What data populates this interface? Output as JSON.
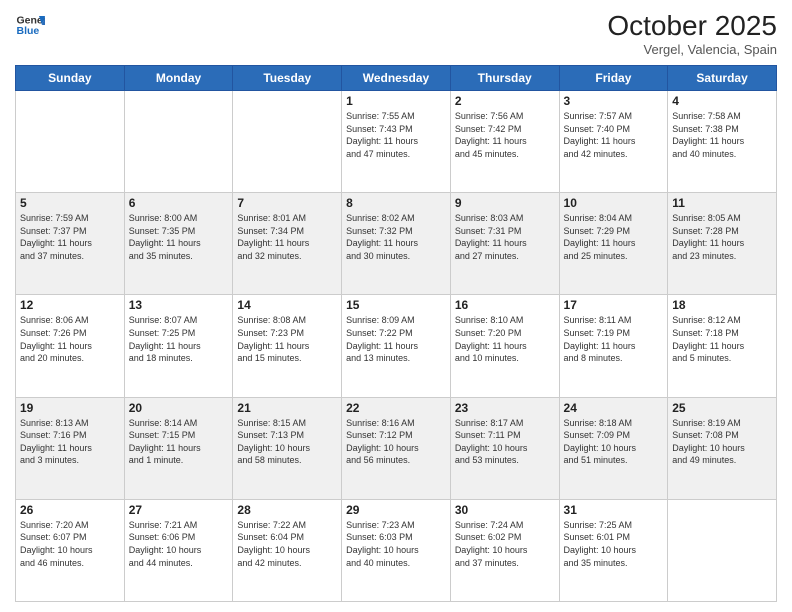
{
  "header": {
    "logo_line1": "General",
    "logo_line2": "Blue",
    "month_title": "October 2025",
    "location": "Vergel, Valencia, Spain"
  },
  "weekdays": [
    "Sunday",
    "Monday",
    "Tuesday",
    "Wednesday",
    "Thursday",
    "Friday",
    "Saturday"
  ],
  "weeks": [
    [
      {
        "day": "",
        "info": ""
      },
      {
        "day": "",
        "info": ""
      },
      {
        "day": "",
        "info": ""
      },
      {
        "day": "1",
        "info": "Sunrise: 7:55 AM\nSunset: 7:43 PM\nDaylight: 11 hours\nand 47 minutes."
      },
      {
        "day": "2",
        "info": "Sunrise: 7:56 AM\nSunset: 7:42 PM\nDaylight: 11 hours\nand 45 minutes."
      },
      {
        "day": "3",
        "info": "Sunrise: 7:57 AM\nSunset: 7:40 PM\nDaylight: 11 hours\nand 42 minutes."
      },
      {
        "day": "4",
        "info": "Sunrise: 7:58 AM\nSunset: 7:38 PM\nDaylight: 11 hours\nand 40 minutes."
      }
    ],
    [
      {
        "day": "5",
        "info": "Sunrise: 7:59 AM\nSunset: 7:37 PM\nDaylight: 11 hours\nand 37 minutes."
      },
      {
        "day": "6",
        "info": "Sunrise: 8:00 AM\nSunset: 7:35 PM\nDaylight: 11 hours\nand 35 minutes."
      },
      {
        "day": "7",
        "info": "Sunrise: 8:01 AM\nSunset: 7:34 PM\nDaylight: 11 hours\nand 32 minutes."
      },
      {
        "day": "8",
        "info": "Sunrise: 8:02 AM\nSunset: 7:32 PM\nDaylight: 11 hours\nand 30 minutes."
      },
      {
        "day": "9",
        "info": "Sunrise: 8:03 AM\nSunset: 7:31 PM\nDaylight: 11 hours\nand 27 minutes."
      },
      {
        "day": "10",
        "info": "Sunrise: 8:04 AM\nSunset: 7:29 PM\nDaylight: 11 hours\nand 25 minutes."
      },
      {
        "day": "11",
        "info": "Sunrise: 8:05 AM\nSunset: 7:28 PM\nDaylight: 11 hours\nand 23 minutes."
      }
    ],
    [
      {
        "day": "12",
        "info": "Sunrise: 8:06 AM\nSunset: 7:26 PM\nDaylight: 11 hours\nand 20 minutes."
      },
      {
        "day": "13",
        "info": "Sunrise: 8:07 AM\nSunset: 7:25 PM\nDaylight: 11 hours\nand 18 minutes."
      },
      {
        "day": "14",
        "info": "Sunrise: 8:08 AM\nSunset: 7:23 PM\nDaylight: 11 hours\nand 15 minutes."
      },
      {
        "day": "15",
        "info": "Sunrise: 8:09 AM\nSunset: 7:22 PM\nDaylight: 11 hours\nand 13 minutes."
      },
      {
        "day": "16",
        "info": "Sunrise: 8:10 AM\nSunset: 7:20 PM\nDaylight: 11 hours\nand 10 minutes."
      },
      {
        "day": "17",
        "info": "Sunrise: 8:11 AM\nSunset: 7:19 PM\nDaylight: 11 hours\nand 8 minutes."
      },
      {
        "day": "18",
        "info": "Sunrise: 8:12 AM\nSunset: 7:18 PM\nDaylight: 11 hours\nand 5 minutes."
      }
    ],
    [
      {
        "day": "19",
        "info": "Sunrise: 8:13 AM\nSunset: 7:16 PM\nDaylight: 11 hours\nand 3 minutes."
      },
      {
        "day": "20",
        "info": "Sunrise: 8:14 AM\nSunset: 7:15 PM\nDaylight: 11 hours\nand 1 minute."
      },
      {
        "day": "21",
        "info": "Sunrise: 8:15 AM\nSunset: 7:13 PM\nDaylight: 10 hours\nand 58 minutes."
      },
      {
        "day": "22",
        "info": "Sunrise: 8:16 AM\nSunset: 7:12 PM\nDaylight: 10 hours\nand 56 minutes."
      },
      {
        "day": "23",
        "info": "Sunrise: 8:17 AM\nSunset: 7:11 PM\nDaylight: 10 hours\nand 53 minutes."
      },
      {
        "day": "24",
        "info": "Sunrise: 8:18 AM\nSunset: 7:09 PM\nDaylight: 10 hours\nand 51 minutes."
      },
      {
        "day": "25",
        "info": "Sunrise: 8:19 AM\nSunset: 7:08 PM\nDaylight: 10 hours\nand 49 minutes."
      }
    ],
    [
      {
        "day": "26",
        "info": "Sunrise: 7:20 AM\nSunset: 6:07 PM\nDaylight: 10 hours\nand 46 minutes."
      },
      {
        "day": "27",
        "info": "Sunrise: 7:21 AM\nSunset: 6:06 PM\nDaylight: 10 hours\nand 44 minutes."
      },
      {
        "day": "28",
        "info": "Sunrise: 7:22 AM\nSunset: 6:04 PM\nDaylight: 10 hours\nand 42 minutes."
      },
      {
        "day": "29",
        "info": "Sunrise: 7:23 AM\nSunset: 6:03 PM\nDaylight: 10 hours\nand 40 minutes."
      },
      {
        "day": "30",
        "info": "Sunrise: 7:24 AM\nSunset: 6:02 PM\nDaylight: 10 hours\nand 37 minutes."
      },
      {
        "day": "31",
        "info": "Sunrise: 7:25 AM\nSunset: 6:01 PM\nDaylight: 10 hours\nand 35 minutes."
      },
      {
        "day": "",
        "info": ""
      }
    ]
  ]
}
